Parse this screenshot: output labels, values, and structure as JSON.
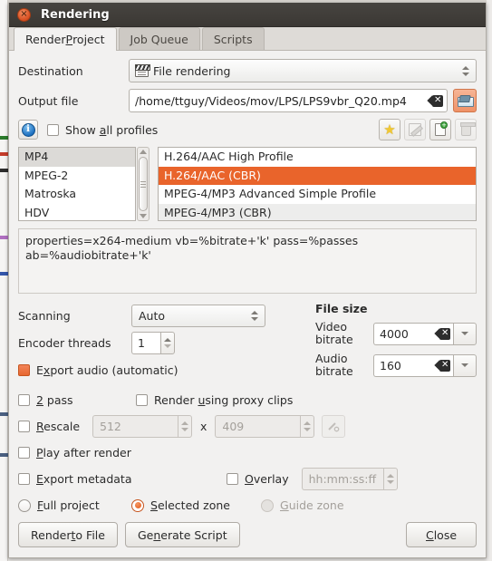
{
  "window": {
    "title": "Rendering",
    "close_icon": "close-icon",
    "close_glyph": "×"
  },
  "tabs": [
    {
      "label_pre": "Render ",
      "label_accel": "P",
      "label_post": "roject",
      "active": true
    },
    {
      "label_pre": "",
      "label_accel": "J",
      "label_post": "ob Queue",
      "active": false
    },
    {
      "label_pre": "Scripts",
      "label_accel": "",
      "label_post": "",
      "active": false
    }
  ],
  "form": {
    "destination_label": "Destination",
    "destination_value": "File rendering",
    "destination_icon": "clapperboard-icon",
    "output_label": "Output file",
    "output_value": "/home/ttguy/Videos/mov/LPS/LPS9vbr_Q20.mp4",
    "output_clear_icon": "clear-icon",
    "browse_icon": "folder-open-icon"
  },
  "profiles": {
    "info_icon": "info-icon",
    "info_glyph": "i",
    "show_all_label_pre": "Show ",
    "show_all_accel": "a",
    "show_all_label_post": "ll profiles",
    "show_all_checked": false,
    "tools": [
      {
        "name": "favorite-button",
        "icon": "star-icon",
        "glyph": "★",
        "enabled": true
      },
      {
        "name": "edit-profile-button",
        "icon": "pencil-icon",
        "glyph": "",
        "enabled": false
      },
      {
        "name": "new-profile-button",
        "icon": "new-document-icon",
        "glyph": "+",
        "enabled": true
      },
      {
        "name": "delete-profile-button",
        "icon": "trash-icon",
        "glyph": "",
        "enabled": false
      }
    ],
    "categories": [
      "MP4",
      "MPEG-2",
      "Matroska",
      "HDV"
    ],
    "selected_category": "MP4",
    "items": [
      "H.264/AAC High Profile",
      "H.264/AAC (CBR)",
      "MPEG-4/MP3 Advanced Simple Profile",
      "MPEG-4/MP3 (CBR)"
    ],
    "selected_item": "H.264/AAC (CBR)"
  },
  "properties_text": "properties=x264-medium vb=%bitrate+'k' pass=%passes\nab=%audiobitrate+'k'",
  "encoding": {
    "scanning_label": "Scanning",
    "scanning_value": "Auto",
    "threads_label": "Encoder threads",
    "threads_value": "1",
    "export_audio_label_pre": "E",
    "export_audio_accel": "x",
    "export_audio_label_post": "port audio (automatic)",
    "export_audio_checked": true
  },
  "filesize": {
    "title": "File size",
    "video_label": "Video\nbitrate",
    "video_label_1": "Video",
    "video_label_2": "bitrate",
    "video_value": "4000",
    "audio_label_1": "Audio",
    "audio_label_2": "bitrate",
    "audio_value": "160",
    "clear_icon": "clear-icon",
    "dropdown_icon": "chevron-down-icon"
  },
  "options": {
    "two_pass_pre": "",
    "two_pass_accel": "2",
    "two_pass_post": " pass",
    "two_pass_checked": false,
    "proxy_pre": "Render ",
    "proxy_accel": "u",
    "proxy_post": "sing proxy clips",
    "proxy_checked": false,
    "rescale_pre": "",
    "rescale_accel": "R",
    "rescale_post": "escale",
    "rescale_checked": false,
    "rescale_width": "512",
    "rescale_separator": "x",
    "rescale_height": "409",
    "rescale_link_icon": "link-icon",
    "play_after_pre": "",
    "play_after_accel": "P",
    "play_after_post": "lay after render",
    "play_after_checked": false,
    "metadata_pre": "",
    "metadata_accel": "E",
    "metadata_post": "xport metadata",
    "metadata_checked": false,
    "overlay_pre": "",
    "overlay_accel": "O",
    "overlay_post": "verlay",
    "overlay_checked": false,
    "overlay_timecode": "hh:mm:ss:ff"
  },
  "zone": {
    "full_pre": "",
    "full_accel": "F",
    "full_post": "ull project",
    "selected_pre": "",
    "selected_accel": "S",
    "selected_post": "elected zone",
    "guide_pre": "",
    "guide_accel": "G",
    "guide_post": "uide zone",
    "selection": "Selected zone"
  },
  "buttons": {
    "render_pre": "Render ",
    "render_accel": "t",
    "render_post": "o File",
    "script_pre": "Ge",
    "script_accel": "n",
    "script_post": "erate Script",
    "close_pre": "",
    "close_accel": "C",
    "close_post": "lose"
  },
  "colors": {
    "accent": "#e9642b",
    "titlebar": "#3b3834",
    "selection": "#e9642b"
  }
}
